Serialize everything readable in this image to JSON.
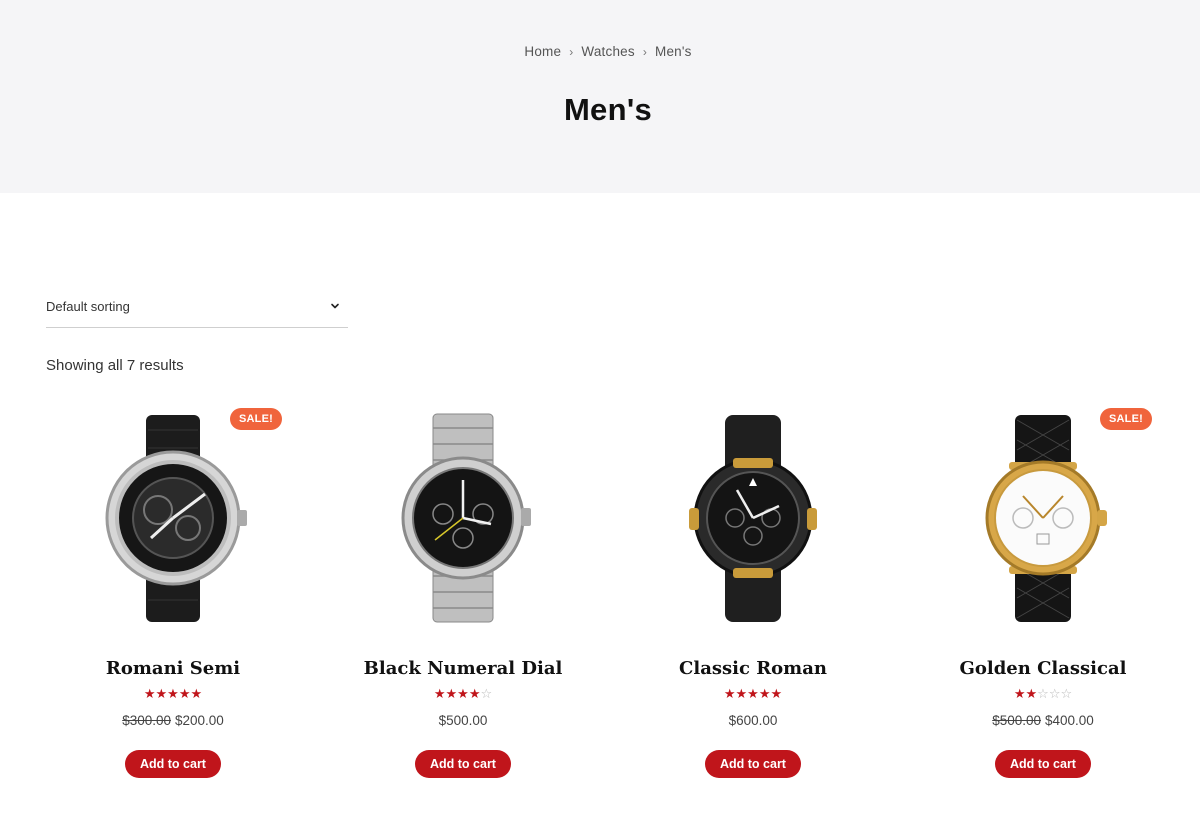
{
  "breadcrumb": {
    "items": [
      "Home",
      "Watches",
      "Men's"
    ],
    "separator": "›"
  },
  "page_title": "Men's",
  "sorting": {
    "selected": "Default sorting"
  },
  "result_count": "Showing all 7 results",
  "colors": {
    "accent": "#c0151b",
    "sale_badge": "#f0643c",
    "hero_bg": "#f5f5f7"
  },
  "products": [
    {
      "name": "Romani Semi",
      "sale_badge": "SALE!",
      "rating": 5,
      "price_old": "$300.00",
      "price": "$200.00",
      "button": "Add to cart",
      "image_icon": "skeleton-watch-black-strap"
    },
    {
      "name": "Black Numeral Dial",
      "sale_badge": "",
      "rating": 4,
      "price_old": "",
      "price": "$500.00",
      "button": "Add to cart",
      "image_icon": "steel-chronograph-watch"
    },
    {
      "name": "Classic Roman",
      "sale_badge": "",
      "rating": 5,
      "price_old": "",
      "price": "$600.00",
      "button": "Add to cart",
      "image_icon": "black-gold-pilot-watch"
    },
    {
      "name": "Golden Classical",
      "sale_badge": "SALE!",
      "rating": 2,
      "price_old": "$500.00",
      "price": "$400.00",
      "button": "Add to cart",
      "image_icon": "gold-white-dial-watch"
    }
  ]
}
